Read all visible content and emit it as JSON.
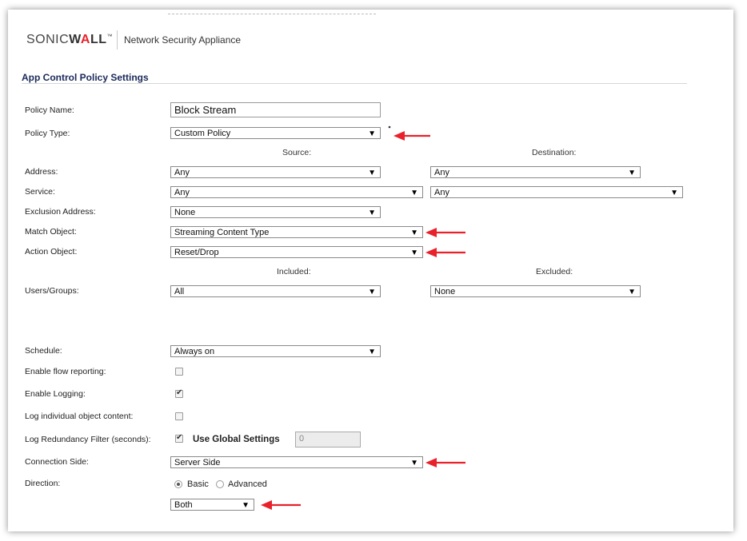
{
  "header": {
    "brand_prefix": "SONIC",
    "brand_wall_1": "W",
    "brand_wall_2": "A",
    "brand_wall_3": "LL",
    "brand_tm": "™",
    "product": "Network Security Appliance"
  },
  "section_title": "App Control Policy Settings",
  "form": {
    "policy_name": {
      "label": "Policy Name:",
      "value": "Block Stream"
    },
    "policy_type": {
      "label": "Policy Type:",
      "value": "Custom Policy"
    },
    "source_header": "Source:",
    "destination_header": "Destination:",
    "address": {
      "label": "Address:",
      "source": "Any",
      "destination": "Any"
    },
    "service": {
      "label": "Service:",
      "source": "Any",
      "destination": "Any"
    },
    "exclusion_address": {
      "label": "Exclusion Address:",
      "value": "None"
    },
    "match_object": {
      "label": "Match Object:",
      "value": "Streaming Content Type"
    },
    "action_object": {
      "label": "Action Object:",
      "value": "Reset/Drop"
    },
    "included_header": "Included:",
    "excluded_header": "Excluded:",
    "users_groups": {
      "label": "Users/Groups:",
      "included": "All",
      "excluded": "None"
    },
    "schedule": {
      "label": "Schedule:",
      "value": "Always on"
    },
    "enable_flow_reporting": {
      "label": "Enable flow reporting:",
      "checked": false
    },
    "enable_logging": {
      "label": "Enable Logging:",
      "checked": true
    },
    "log_individual": {
      "label": "Log individual object content:",
      "checked": false
    },
    "log_redundancy": {
      "label": "Log Redundancy Filter (seconds):",
      "checked": true,
      "use_global_label": "Use Global Settings",
      "value": "0"
    },
    "connection_side": {
      "label": "Connection Side:",
      "value": "Server Side"
    },
    "direction": {
      "label": "Direction:",
      "basic_label": "Basic",
      "advanced_label": "Advanced",
      "selected": "Basic",
      "value": "Both"
    }
  },
  "colors": {
    "annotation_arrow": "#e8212a",
    "section_title": "#1a2a5a",
    "brand_accent": "#e8212a"
  }
}
